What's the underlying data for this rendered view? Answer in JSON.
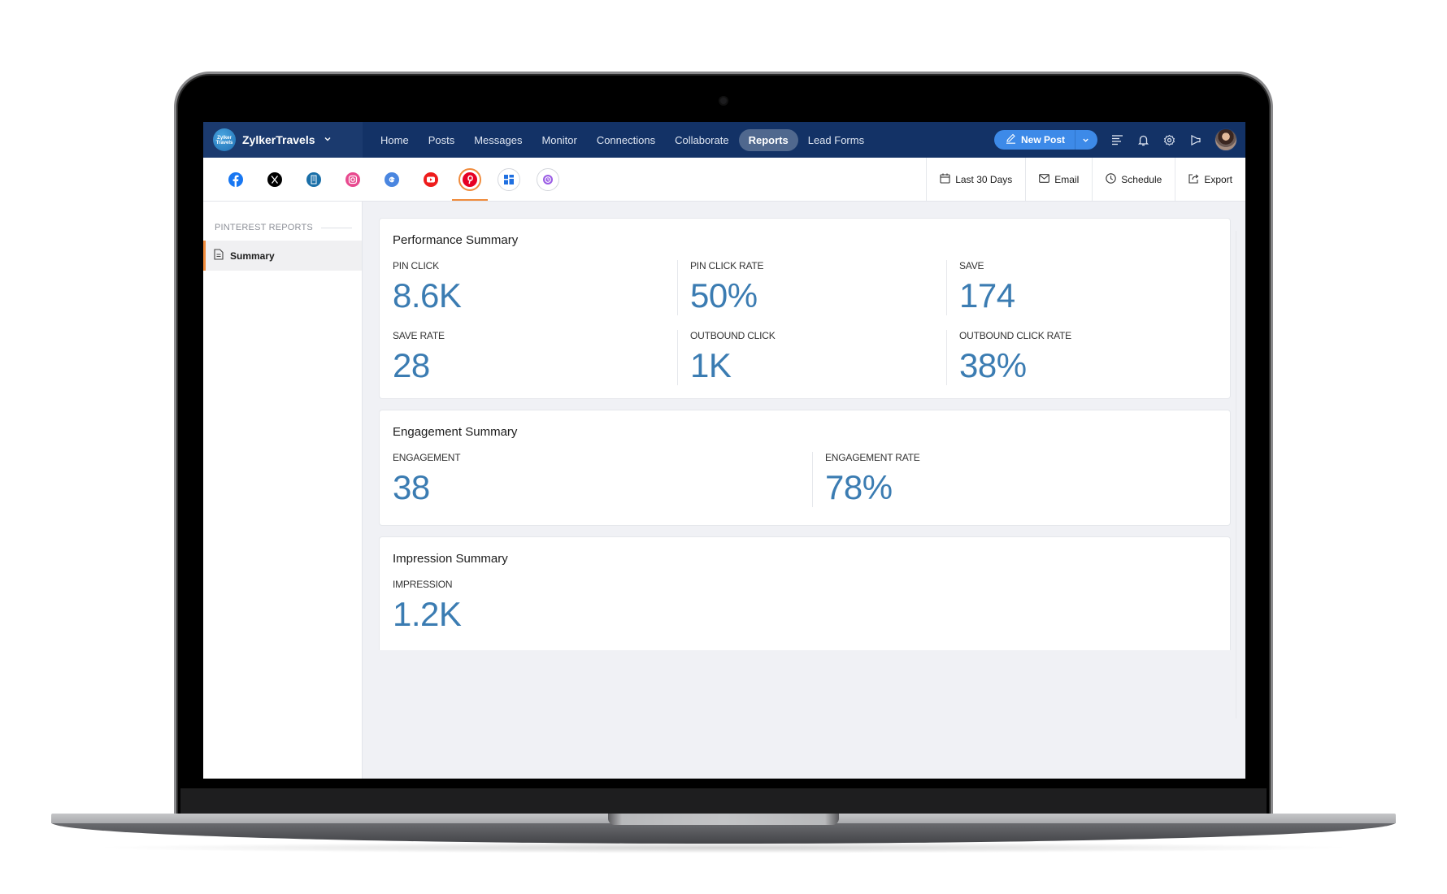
{
  "app": {
    "brand_name": "ZylkerTravels",
    "brand_logo_text": "Zylker Travels"
  },
  "nav": {
    "items": [
      {
        "label": "Home",
        "active": false
      },
      {
        "label": "Posts",
        "active": false
      },
      {
        "label": "Messages",
        "active": false
      },
      {
        "label": "Monitor",
        "active": false
      },
      {
        "label": "Connections",
        "active": false
      },
      {
        "label": "Collaborate",
        "active": false
      },
      {
        "label": "Reports",
        "active": true
      },
      {
        "label": "Lead Forms",
        "active": false
      }
    ],
    "new_post_label": "New Post",
    "tool_icons": [
      "menu-lines-icon",
      "bell-icon",
      "gear-icon",
      "megaphone-icon",
      "avatar"
    ]
  },
  "channels": [
    {
      "name": "facebook",
      "color": "#1877f2",
      "active": false
    },
    {
      "name": "x-twitter",
      "color": "#000000",
      "active": false
    },
    {
      "name": "linkedin-page",
      "color": "#0a66c2",
      "active": false
    },
    {
      "name": "instagram",
      "color": "#e1306c",
      "active": false
    },
    {
      "name": "google-business",
      "color": "#4285f4",
      "active": false
    },
    {
      "name": "youtube",
      "color": "#ff0000",
      "active": false
    },
    {
      "name": "pinterest",
      "color": "#e60023",
      "active": true
    },
    {
      "name": "tiktok-widget",
      "color": "#1f6fe0",
      "active": false
    },
    {
      "name": "threads-mastodon",
      "color": "#9b5de5",
      "active": false
    }
  ],
  "actions": {
    "date_range": "Last 30 Days",
    "email": "Email",
    "schedule": "Schedule",
    "export": "Export"
  },
  "sidebar": {
    "section_title": "PINTEREST REPORTS",
    "items": [
      {
        "label": "Summary",
        "active": true
      }
    ]
  },
  "cards": {
    "performance": {
      "title": "Performance Summary",
      "metrics": [
        {
          "label": "PIN CLICK",
          "value": "8.6K"
        },
        {
          "label": "PIN CLICK RATE",
          "value": "50%"
        },
        {
          "label": "SAVE",
          "value": "174"
        },
        {
          "label": "SAVE RATE",
          "value": "28"
        },
        {
          "label": "OUTBOUND CLICK",
          "value": "1K"
        },
        {
          "label": "OUTBOUND CLICK RATE",
          "value": "38%"
        }
      ]
    },
    "engagement": {
      "title": "Engagement Summary",
      "metrics": [
        {
          "label": "ENGAGEMENT",
          "value": "38"
        },
        {
          "label": "ENGAGEMENT RATE",
          "value": "78%"
        }
      ]
    },
    "impression": {
      "title": "Impression Summary",
      "metrics": [
        {
          "label": "IMPRESSION",
          "value": "1.2K"
        }
      ]
    }
  },
  "colors": {
    "header_bg": "#133266",
    "accent_orange": "#f08b3c",
    "metric_value": "#3b7cb2",
    "new_post_bg": "#3d8ae8"
  }
}
